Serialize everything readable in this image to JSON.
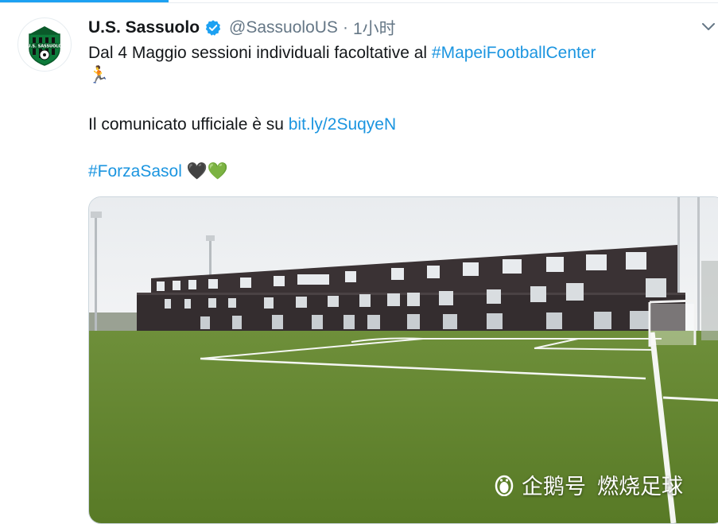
{
  "tweet": {
    "author": {
      "display_name": "U.S. Sassuolo",
      "handle": "@SassuoloUS",
      "separator": "·",
      "time": "1小时",
      "avatar_text": "U.S. SASSUOLO"
    },
    "text": {
      "line1": "Dal 4 Maggio sessioni individuali facoltative al ",
      "hashtag_center": "#MapeiFootballCenter",
      "emoji_line": "🏃",
      "line3_prefix": "Il comunicato ufficiale è su ",
      "link": "bit.ly/2SuqyeN",
      "hashtag_forza": "#ForzaSasol",
      "emojis": "🖤💚"
    }
  },
  "watermark": {
    "platform": "企鹅号",
    "account": "燃烧足球"
  },
  "icons": {
    "verified": "verified-badge-icon",
    "caret": "chevron-down-icon",
    "watermark": "penguin-icon"
  },
  "colors": {
    "link": "#1b95e0",
    "verified": "#1da1f2",
    "name": "#14171a",
    "meta": "#657786"
  }
}
